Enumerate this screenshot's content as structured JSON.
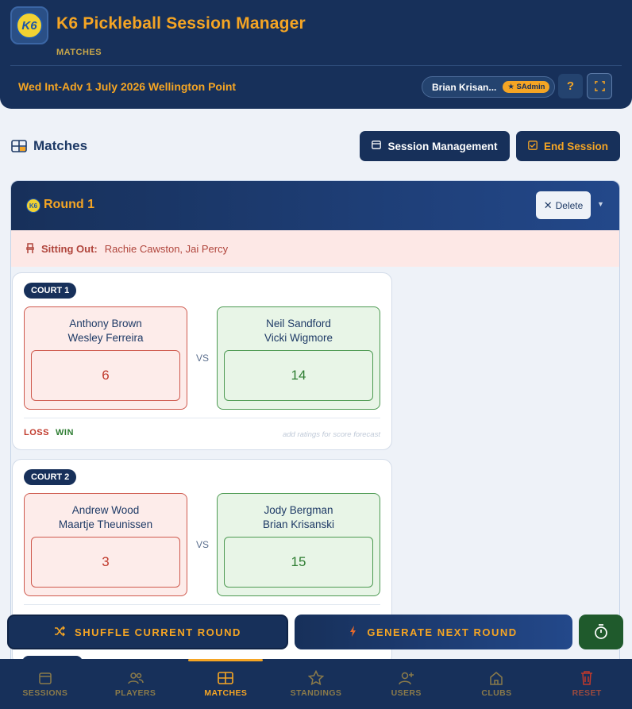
{
  "header": {
    "logo_text": "K6",
    "title": "K6 Pickleball Session Manager",
    "subtitle": "MATCHES",
    "session": "Wed Int-Adv 1 July 2026 Wellington Point",
    "user_name": "Brian Krisan...",
    "role_badge": "★ SAdmin",
    "help_label": "?",
    "icons": {
      "help": "question-icon",
      "fullscreen": "fullscreen-icon"
    }
  },
  "toolbar": {
    "heading": "Matches",
    "session_management": "Session Management",
    "end_session": "End Session",
    "icons": {
      "heading": "grid-icon",
      "session_management": "calendar-icon",
      "end_session": "check-square-icon"
    }
  },
  "round": {
    "title": "Round 1",
    "delete_label": "Delete",
    "sitting_out_label": "Sitting Out:",
    "sitting_out_names": "Rachie Cawston, Jai Percy",
    "courts": [
      {
        "label": "COURT 1",
        "team_a": {
          "player1": "Anthony Brown",
          "player2": "Wesley Ferreira",
          "score": "6",
          "result": "loss"
        },
        "vs": "VS",
        "team_b": {
          "player1": "Neil Sandford",
          "player2": "Vicki Wigmore",
          "score": "14",
          "result": "win"
        },
        "result_a": "LOSS",
        "result_b": "WIN",
        "hint": "add ratings for score forecast"
      },
      {
        "label": "COURT 2",
        "team_a": {
          "player1": "Andrew Wood",
          "player2": "Maartje Theunissen",
          "score": "3",
          "result": "loss"
        },
        "vs": "VS",
        "team_b": {
          "player1": "Jody Bergman",
          "player2": "Brian Krisanski",
          "score": "15",
          "result": "win"
        }
      }
    ]
  },
  "actions": {
    "shuffle": "SHUFFLE CURRENT ROUND",
    "generate": "GENERATE NEXT ROUND",
    "icons": {
      "shuffle": "shuffle-icon",
      "generate": "lightning-icon",
      "timer": "stopwatch-icon"
    }
  },
  "nav": {
    "items": [
      {
        "label": "SESSIONS",
        "icon": "calendar-icon"
      },
      {
        "label": "PLAYERS",
        "icon": "users-icon"
      },
      {
        "label": "MATCHES",
        "icon": "grid-icon",
        "active": true
      },
      {
        "label": "STANDINGS",
        "icon": "star-icon"
      },
      {
        "label": "USERS",
        "icon": "user-plus-icon"
      },
      {
        "label": "CLUBS",
        "icon": "home-icon"
      },
      {
        "label": "RESET",
        "icon": "trash-icon"
      }
    ]
  },
  "colors": {
    "navy": "#17305a",
    "accent": "#f5a524",
    "loss": "#c0392b",
    "win": "#2e7d32"
  }
}
